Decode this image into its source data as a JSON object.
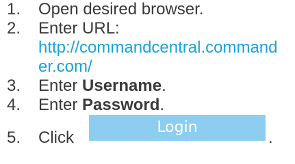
{
  "steps": [
    {
      "number": "1.",
      "text": "Open desired browser."
    },
    {
      "number": "2.",
      "text": "Enter URL:",
      "url": "http://commandcentral.commander.com/"
    },
    {
      "number": "3.",
      "prefix": "Enter ",
      "bold": "Username",
      "suffix": "."
    },
    {
      "number": "4.",
      "prefix": "Enter ",
      "bold": "Password",
      "suffix": "."
    },
    {
      "number": "5.",
      "prefix": "Click",
      "button_label": "Login",
      "suffix": "."
    }
  ],
  "colors": {
    "text": "#3a3a3a",
    "link": "#1aa3d9",
    "button_bg": "#8dcdf0",
    "button_text": "#ffffff"
  }
}
